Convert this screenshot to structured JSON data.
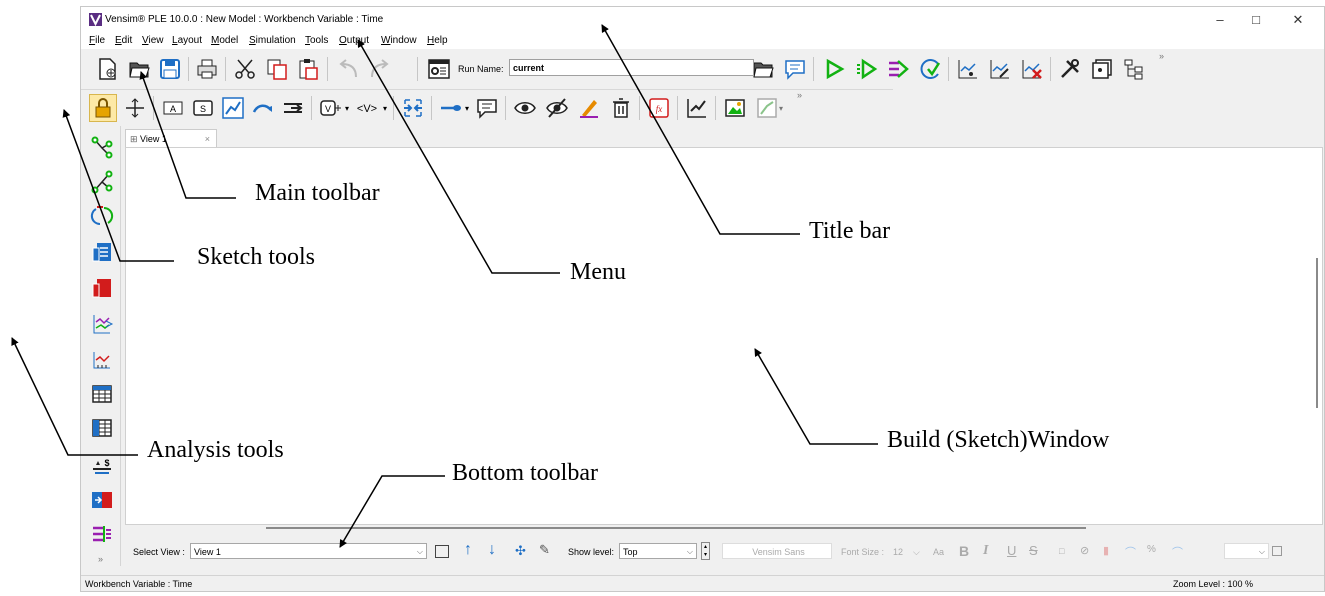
{
  "window": {
    "title": "Vensim® PLE 10.0.0 : New Model : Workbench Variable : Time",
    "controls": [
      "–",
      "□",
      "✕"
    ]
  },
  "menu": [
    "File",
    "Edit",
    "View",
    "Layout",
    "Model",
    "Simulation",
    "Tools",
    "Output",
    "Window",
    "Help"
  ],
  "main_toolbar": {
    "run_name_label": "Run Name:",
    "run_name_value": "current",
    "buttons": [
      "new-model",
      "open-model",
      "save",
      "print",
      "cut",
      "copy",
      "paste",
      "undo",
      "redo",
      "sim-setup",
      "open-folder",
      "comment",
      "run",
      "run-step",
      "synthesim",
      "reality-check",
      "load-runs",
      "compare-runs",
      "delete-runs",
      "control-panel",
      "output-window",
      "tree"
    ],
    "overflow": "»"
  },
  "sketch_toolbar": {
    "buttons": [
      "lock",
      "move",
      "variable",
      "box-variable",
      "arrow",
      "rate",
      "equation-text",
      "shadow-variable",
      "input-output",
      "flow",
      "cloud",
      "comment",
      "show",
      "hide",
      "color",
      "delete",
      "equations",
      "causes-tree",
      "graph",
      "table"
    ],
    "overflow": "»"
  },
  "analysis_tools": [
    "causes-tree",
    "uses-tree",
    "loops",
    "document",
    "causes-strip",
    "graph",
    "bar-graph",
    "table",
    "table-time-down",
    "balance",
    "compare",
    "gaming"
  ],
  "tab": {
    "label": "View 1",
    "close": "×"
  },
  "bottom_toolbar": {
    "select_view_label": "Select View :",
    "select_view_value": "View 1",
    "show_level_label": "Show level:",
    "show_level_value": "Top",
    "font_name": "Vensim Sans",
    "font_size_label": "Font Size :",
    "font_size_value": "12",
    "aa": "Aa",
    "bold": "B",
    "italic": "I",
    "underline": "U",
    "strike": "S"
  },
  "status_bar": {
    "left": "Workbench Variable : Time",
    "zoom": "Zoom Level : 100 %"
  },
  "annotations": {
    "title_bar": "Title bar",
    "main_toolbar": "Main toolbar",
    "sketch_tools": "Sketch tools",
    "menu": "Menu",
    "analysis_tools": "Analysis tools",
    "bottom_toolbar": "Bottom toolbar",
    "build_window": "Build (Sketch)Window"
  },
  "colors": {
    "run_green": "#12b212",
    "accent_blue": "#1f6fc5",
    "icon_red": "#d21c1c",
    "icon_purple": "#9a1fb0"
  }
}
